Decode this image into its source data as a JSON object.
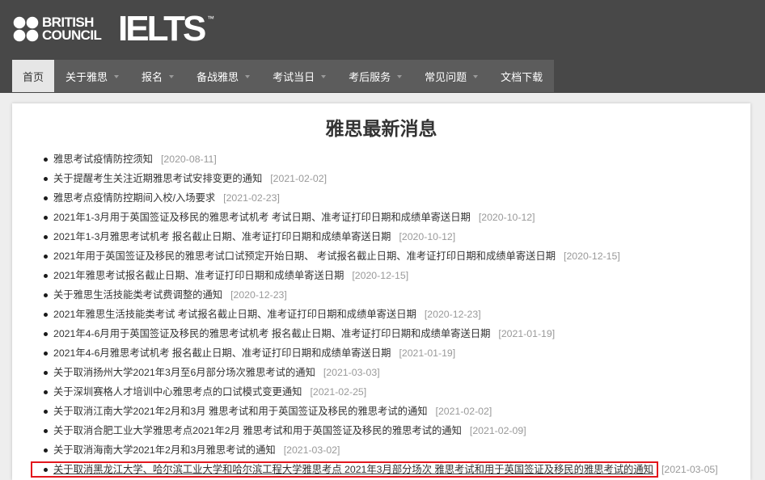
{
  "header": {
    "brand_line1": "BRITISH",
    "brand_line2": "COUNCIL",
    "product": "IELTS",
    "trademark": "™"
  },
  "nav": {
    "items": [
      {
        "label": "首页",
        "active": true,
        "has_dropdown": false
      },
      {
        "label": "关于雅思",
        "active": false,
        "has_dropdown": true
      },
      {
        "label": "报名",
        "active": false,
        "has_dropdown": true
      },
      {
        "label": "备战雅思",
        "active": false,
        "has_dropdown": true
      },
      {
        "label": "考试当日",
        "active": false,
        "has_dropdown": true
      },
      {
        "label": "考后服务",
        "active": false,
        "has_dropdown": true
      },
      {
        "label": "常见问题",
        "active": false,
        "has_dropdown": true
      },
      {
        "label": "文档下载",
        "active": false,
        "has_dropdown": false
      }
    ]
  },
  "news": {
    "title": "雅思最新消息",
    "items": [
      {
        "title": "雅思考试疫情防控须知",
        "date": "[2020-08-11]"
      },
      {
        "title": "关于提醒考生关注近期雅思考试安排变更的通知",
        "date": "[2021-02-02]"
      },
      {
        "title": "雅思考点疫情防控期间入校/入场要求",
        "date": "[2021-02-23]"
      },
      {
        "title": "2021年1-3月用于英国签证及移民的雅思考试机考 考试日期、准考证打印日期和成绩单寄送日期",
        "date": "[2020-10-12]"
      },
      {
        "title": "2021年1-3月雅思考试机考 报名截止日期、准考证打印日期和成绩单寄送日期",
        "date": "[2020-10-12]"
      },
      {
        "title": "2021年用于英国签证及移民的雅思考试口试预定开始日期、 考试报名截止日期、准考证打印日期和成绩单寄送日期",
        "date": "[2020-12-15]"
      },
      {
        "title": "2021年雅思考试报名截止日期、准考证打印日期和成绩单寄送日期",
        "date": "[2020-12-15]"
      },
      {
        "title": "关于雅思生活技能类考试费调整的通知",
        "date": "[2020-12-23]"
      },
      {
        "title": "2021年雅思生活技能类考试 考试报名截止日期、准考证打印日期和成绩单寄送日期",
        "date": "[2020-12-23]"
      },
      {
        "title": "2021年4-6月用于英国签证及移民的雅思考试机考 报名截止日期、准考证打印日期和成绩单寄送日期",
        "date": "[2021-01-19]"
      },
      {
        "title": "2021年4-6月雅思考试机考 报名截止日期、准考证打印日期和成绩单寄送日期",
        "date": "[2021-01-19]"
      },
      {
        "title": "关于取消扬州大学2021年3月至6月部分场次雅思考试的通知",
        "date": "[2021-03-03]"
      },
      {
        "title": "关于深圳赛格人才培训中心雅思考点的口试模式变更通知",
        "date": "[2021-02-25]"
      },
      {
        "title": "关于取消江南大学2021年2月和3月 雅思考试和用于英国签证及移民的雅思考试的通知",
        "date": "[2021-02-02]"
      },
      {
        "title": "关于取消合肥工业大学雅思考点2021年2月 雅思考试和用于英国签证及移民的雅思考试的通知",
        "date": "[2021-02-09]"
      },
      {
        "title": "关于取消海南大学2021年2月和3月雅思考试的通知",
        "date": "[2021-03-02]"
      },
      {
        "title": "关于取消黑龙江大学、哈尔滨工业大学和哈尔滨工程大学雅思考点 2021年3月部分场次 雅思考试和用于英国签证及移民的雅思考试的通知",
        "date": "[2021-03-05]",
        "highlighted": true,
        "underlined": true
      }
    ]
  },
  "colors": {
    "page-bg": "#eeeeee",
    "header-bg": "#484848",
    "nav-bg": "#5c5c5c",
    "active-tab-bg": "#e6e6e6",
    "link-text": "#333333",
    "date-text": "#999999",
    "highlight-border": "#e3161d"
  }
}
